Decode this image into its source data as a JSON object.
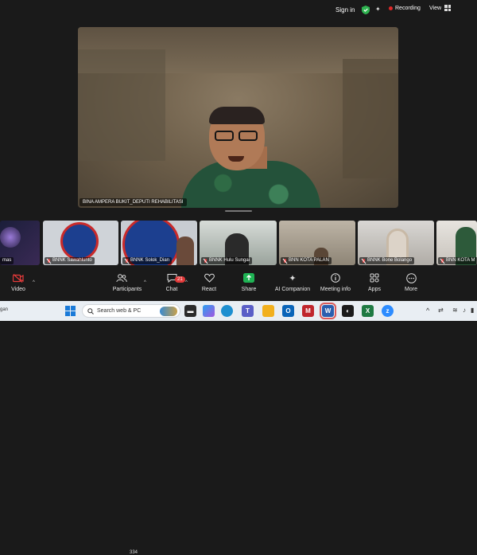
{
  "topbar": {
    "signin_label": "Sign in",
    "recording_label": "Recording",
    "view_label": "View"
  },
  "main_video": {
    "participant_name": "BINA AMPERA BUKIT_DEPUTI REHABILITASI"
  },
  "participants_strip": [
    {
      "name": "mas"
    },
    {
      "name": "BNNK Sawahlunto"
    },
    {
      "name": "BNNK Solok_Dian"
    },
    {
      "name": "BNNK Hulu Sungai"
    },
    {
      "name": "BNN KOTA PALAN"
    },
    {
      "name": "BNNK Bone Bolango"
    },
    {
      "name": "BNN KOTA M"
    }
  ],
  "toolbar": {
    "video_label": "Video",
    "participants_label": "Participants",
    "participants_count": "334",
    "chat_label": "Chat",
    "chat_badge": "21",
    "react_label": "React",
    "share_label": "Share",
    "ai_label": "AI Companion",
    "meeting_info_label": "Meeting info",
    "apps_label": "Apps",
    "more_label": "More"
  },
  "taskbar": {
    "left_text": "gan",
    "search_placeholder": "Search web & PC"
  },
  "colors": {
    "recording": "#e02828",
    "share_green": "#1fb354",
    "chat_badge": "#e23a3a",
    "taskbar_bg": "#e9eef3"
  }
}
